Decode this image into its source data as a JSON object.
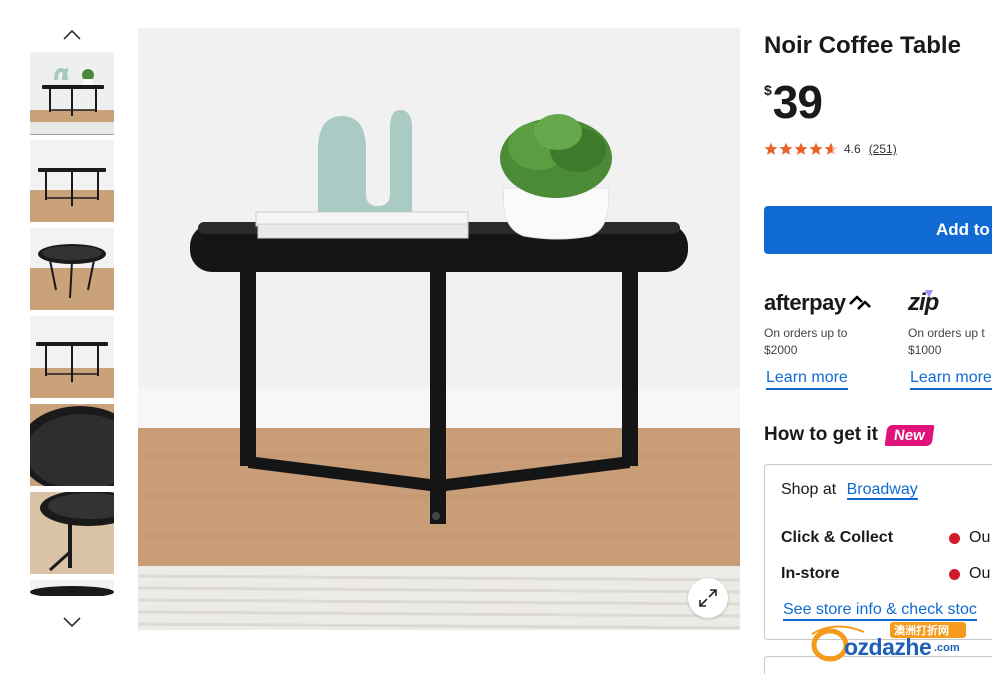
{
  "gallery": {
    "thumb_count": 7,
    "active_index": 0
  },
  "product": {
    "title": "Noir Coffee Table",
    "currency_symbol": "$",
    "price": "39",
    "rating": {
      "value": 4.6,
      "score_text": "4.6",
      "count_text": "(251)",
      "star_color": "#e8622a"
    }
  },
  "actions": {
    "add_to_cart_label": "Add to"
  },
  "payments": [
    {
      "brand": "afterpay",
      "note_line1": "On orders up to",
      "note_line2": "$2000",
      "link": "Learn more"
    },
    {
      "brand": "zip",
      "note_line1": "On orders up t",
      "note_line2": "$1000",
      "link": "Learn more"
    }
  ],
  "fulfilment": {
    "heading": "How to get it",
    "badge": "New",
    "shop_at_label": "Shop at",
    "store_name": "Broadway",
    "click_collect_label": "Click & Collect",
    "click_collect_status": "Ou",
    "in_store_label": "In-store",
    "in_store_status": "Ou",
    "store_info_link": "See store info & check stoc"
  },
  "watermark": {
    "text": "ozdazhe",
    "suffix": ".com",
    "chinese": "澳洲打折网"
  },
  "colors": {
    "accent_blue": "#0f6bd3",
    "badge_pink": "#e0137a",
    "status_red": "#d11a2a",
    "afterpay_mint": "#b2fce4",
    "zip_purple": "#aa8ff8"
  }
}
